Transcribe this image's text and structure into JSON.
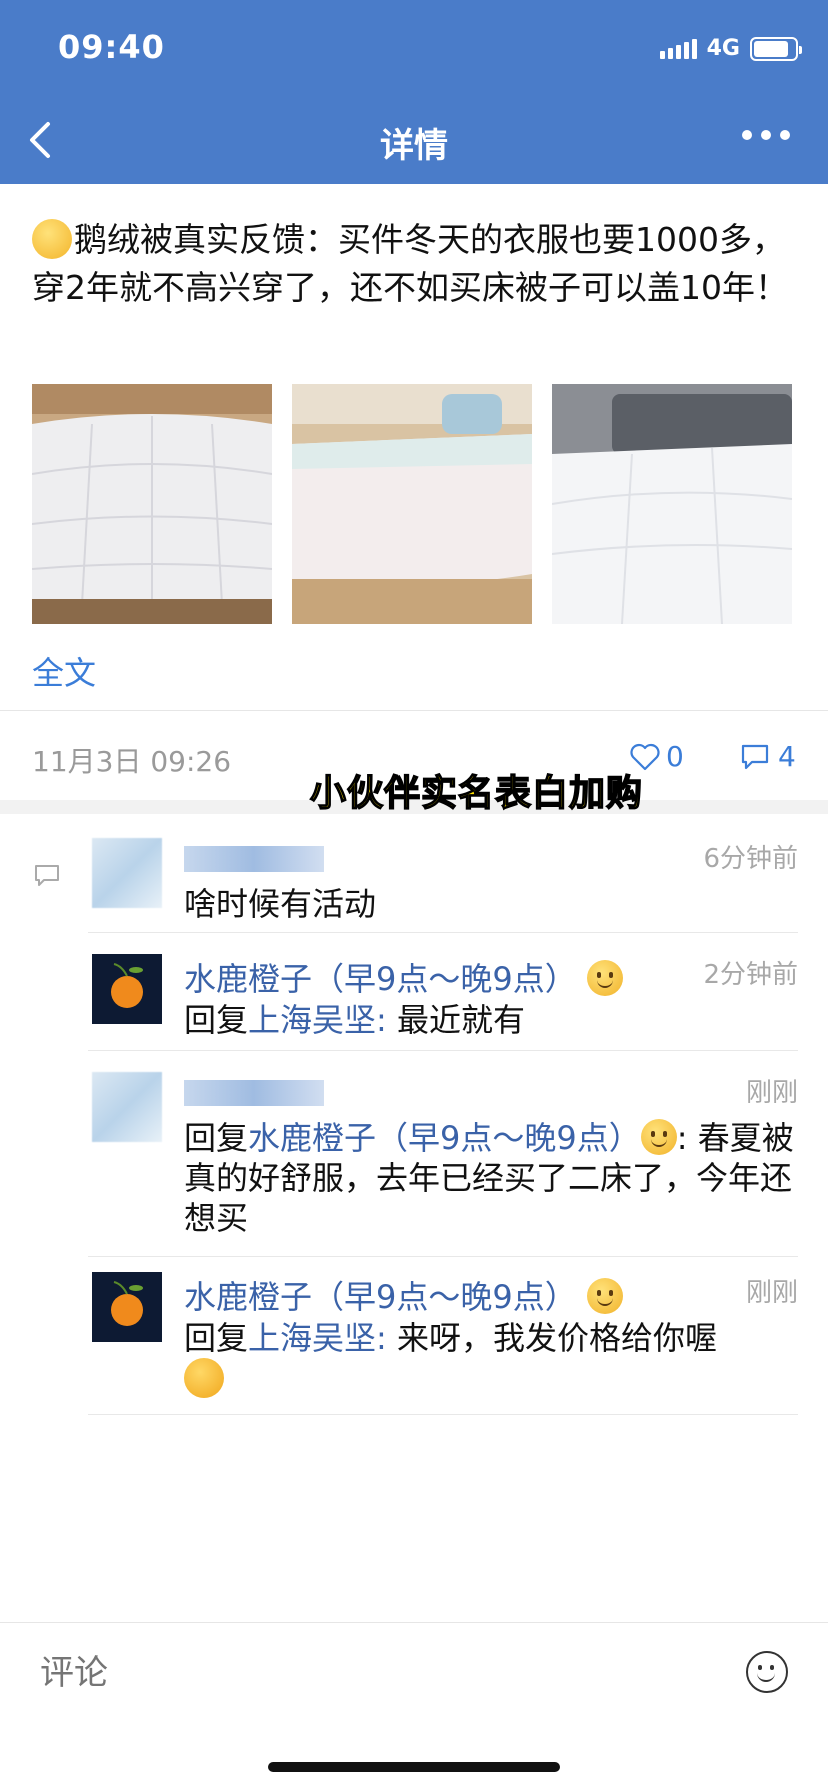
{
  "status_bar": {
    "time": "09:40",
    "network": "4G",
    "battery_level": 0.85
  },
  "nav": {
    "title": "详情"
  },
  "post": {
    "text": "鹅绒被真实反馈：买件冬天的衣服也要1000多，穿2年就不高兴穿了，还不如买床被子可以盖10年！",
    "full_text_link": "全文",
    "date": "11月3日 09:26",
    "likes": "0",
    "comments": "4"
  },
  "overlay_caption": "小伙伴实名表白加购",
  "comments": [
    {
      "name": "",
      "time": "6分钟前",
      "prefix": "",
      "reply_to": "",
      "text": "啥时候有活动"
    },
    {
      "name": "水鹿橙子（早9点～晚9点）",
      "time": "2分钟前",
      "prefix": "回复",
      "reply_to": "上海吴坚:",
      "text": " 最近就有"
    },
    {
      "name": "",
      "time": "刚刚",
      "prefix": "回复",
      "reply_to": "水鹿橙子（早9点～晚9点）",
      "text": ": 春夏被真的好舒服，去年已经买了二床了，今年还想买"
    },
    {
      "name": "水鹿橙子（早9点～晚9点）",
      "time": "刚刚",
      "prefix": "回复",
      "reply_to": "上海吴坚:",
      "text": " 来呀，我发价格给你喔"
    }
  ],
  "comment_input": {
    "placeholder": "评论"
  },
  "icons": {
    "back": "chevron-left-icon",
    "more": "more-icon",
    "like": "heart-icon",
    "comment": "comment-icon",
    "emoji": "emoji-icon"
  }
}
